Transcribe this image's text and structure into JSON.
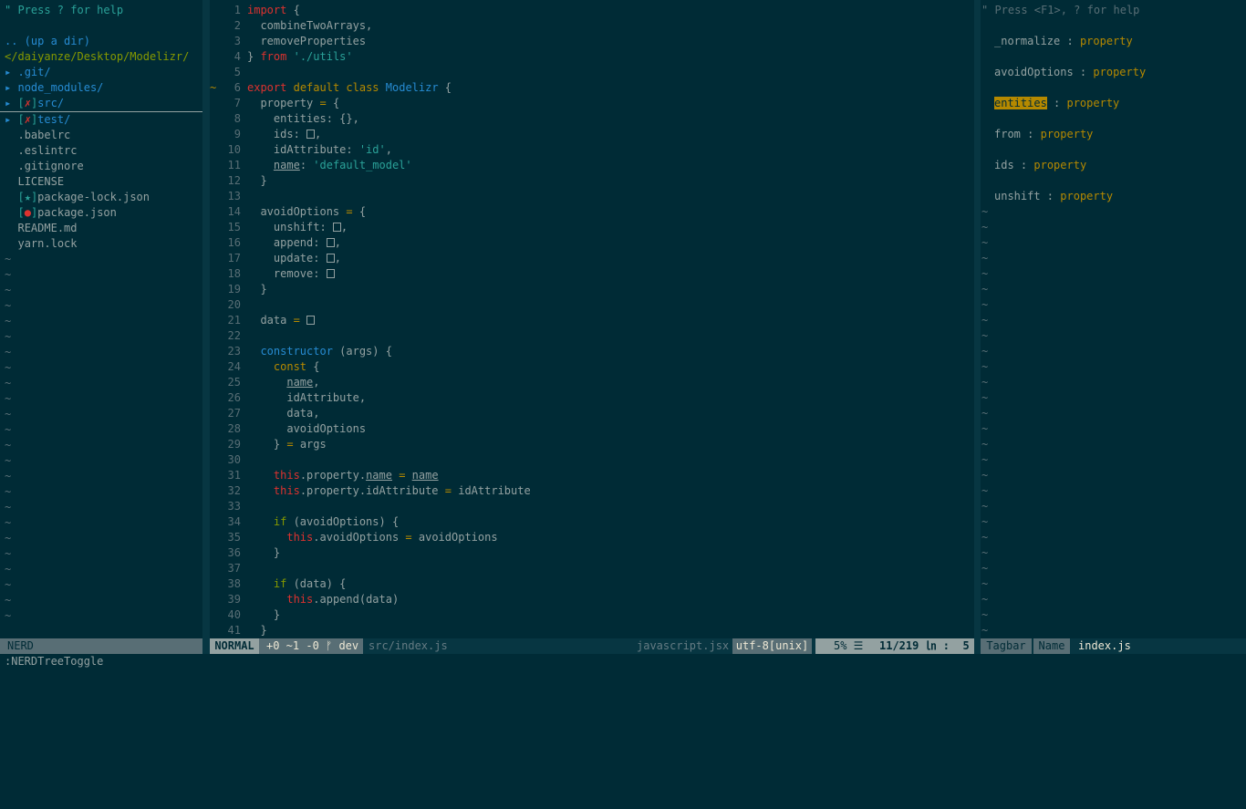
{
  "nerdtree": {
    "help": "\" Press ? for help",
    "up": ".. (up a dir)",
    "root": "</daiyanze/Desktop/Modelizr/",
    "entries": [
      {
        "arrow": "▸",
        "mark": "",
        "name": ".git/",
        "type": "dir"
      },
      {
        "arrow": "▸",
        "mark": "",
        "name": "node_modules/",
        "type": "dir"
      },
      {
        "arrow": "▸",
        "mark": "✗",
        "name": "src/",
        "type": "dir"
      },
      {
        "arrow": "▸",
        "mark": "✗",
        "name": "test/",
        "type": "dir"
      },
      {
        "arrow": " ",
        "mark": "",
        "name": ".babelrc",
        "type": "file"
      },
      {
        "arrow": " ",
        "mark": "",
        "name": ".eslintrc",
        "type": "file"
      },
      {
        "arrow": " ",
        "mark": "",
        "name": ".gitignore",
        "type": "file"
      },
      {
        "arrow": " ",
        "mark": "",
        "name": "LICENSE",
        "type": "file"
      },
      {
        "arrow": " ",
        "mark": "★",
        "name": "package-lock.json",
        "type": "file"
      },
      {
        "arrow": " ",
        "mark": "●",
        "name": "package.json",
        "type": "file"
      },
      {
        "arrow": " ",
        "mark": "",
        "name": "README.md",
        "type": "file"
      },
      {
        "arrow": " ",
        "mark": "",
        "name": "yarn.lock",
        "type": "file"
      }
    ],
    "empty_marker": "~"
  },
  "editor": {
    "lines": [
      [
        [
          "import",
          "kw"
        ],
        [
          " {",
          "t"
        ]
      ],
      [
        [
          "  combineTwoArrays,",
          "t"
        ]
      ],
      [
        [
          "  removeProperties",
          "t"
        ]
      ],
      [
        [
          "} ",
          "t"
        ],
        [
          "from",
          "kw"
        ],
        [
          " ",
          "t"
        ],
        [
          "'./utils'",
          "str"
        ]
      ],
      [],
      [
        [
          "export",
          "kw"
        ],
        [
          " ",
          "t"
        ],
        [
          "default",
          "op"
        ],
        [
          " ",
          "t"
        ],
        [
          "class",
          "op"
        ],
        [
          " ",
          "t"
        ],
        [
          "Modelizr",
          "fn"
        ],
        [
          " {",
          "t"
        ]
      ],
      [
        [
          "  property ",
          "t"
        ],
        [
          "=",
          "op"
        ],
        [
          " {",
          "t"
        ]
      ],
      [
        [
          "    entities: {},",
          "t"
        ]
      ],
      [
        [
          "    ids: ",
          "t"
        ],
        [
          "[]",
          "box"
        ],
        [
          ",",
          "t"
        ]
      ],
      [
        [
          "    idAttribute: ",
          "t"
        ],
        [
          "'id'",
          "str"
        ],
        [
          ",",
          "t"
        ]
      ],
      [
        [
          "    ",
          "t"
        ],
        [
          "name",
          "u"
        ],
        [
          ": ",
          "t"
        ],
        [
          "'default_model'",
          "str"
        ]
      ],
      [
        [
          "  }",
          "t"
        ]
      ],
      [],
      [
        [
          "  avoidOptions ",
          "t"
        ],
        [
          "=",
          "op"
        ],
        [
          " {",
          "t"
        ]
      ],
      [
        [
          "    unshift: ",
          "t"
        ],
        [
          "[]",
          "box"
        ],
        [
          ",",
          "t"
        ]
      ],
      [
        [
          "    append: ",
          "t"
        ],
        [
          "[]",
          "box"
        ],
        [
          ",",
          "t"
        ]
      ],
      [
        [
          "    update: ",
          "t"
        ],
        [
          "[]",
          "box"
        ],
        [
          ",",
          "t"
        ]
      ],
      [
        [
          "    remove: ",
          "t"
        ],
        [
          "[]",
          "box"
        ]
      ],
      [
        [
          "  }",
          "t"
        ]
      ],
      [],
      [
        [
          "  data ",
          "t"
        ],
        [
          "=",
          "op"
        ],
        [
          " ",
          "t"
        ],
        [
          "[]",
          "box"
        ]
      ],
      [],
      [
        [
          "  ",
          "t"
        ],
        [
          "constructor",
          "fn"
        ],
        [
          " (args) {",
          "t"
        ]
      ],
      [
        [
          "    ",
          "t"
        ],
        [
          "const",
          "op"
        ],
        [
          " {",
          "t"
        ]
      ],
      [
        [
          "      ",
          "t"
        ],
        [
          "name",
          "u"
        ],
        [
          ",",
          "t"
        ]
      ],
      [
        [
          "      idAttribute,",
          "t"
        ]
      ],
      [
        [
          "      data,",
          "t"
        ]
      ],
      [
        [
          "      avoidOptions",
          "t"
        ]
      ],
      [
        [
          "    } ",
          "t"
        ],
        [
          "=",
          "op"
        ],
        [
          " args",
          "t"
        ]
      ],
      [],
      [
        [
          "    ",
          "t"
        ],
        [
          "this",
          "this"
        ],
        [
          ".property.",
          "t"
        ],
        [
          "name",
          "u"
        ],
        [
          " ",
          "t"
        ],
        [
          "=",
          "op"
        ],
        [
          " ",
          "t"
        ],
        [
          "name",
          "u"
        ]
      ],
      [
        [
          "    ",
          "t"
        ],
        [
          "this",
          "this"
        ],
        [
          ".property.idAttribute ",
          "t"
        ],
        [
          "=",
          "op"
        ],
        [
          " idAttribute",
          "t"
        ]
      ],
      [],
      [
        [
          "    ",
          "t"
        ],
        [
          "if",
          "st"
        ],
        [
          " (avoidOptions) {",
          "t"
        ]
      ],
      [
        [
          "      ",
          "t"
        ],
        [
          "this",
          "this"
        ],
        [
          ".avoidOptions ",
          "t"
        ],
        [
          "=",
          "op"
        ],
        [
          " avoidOptions",
          "t"
        ]
      ],
      [
        [
          "    }",
          "t"
        ]
      ],
      [],
      [
        [
          "    ",
          "t"
        ],
        [
          "if",
          "st"
        ],
        [
          " (data) {",
          "t"
        ]
      ],
      [
        [
          "      ",
          "t"
        ],
        [
          "this",
          "this"
        ],
        [
          ".append(data)",
          "t"
        ]
      ],
      [
        [
          "    }",
          "t"
        ]
      ],
      [
        [
          "  }",
          "t"
        ]
      ]
    ],
    "sign_line": 6,
    "sign_char": "~"
  },
  "tagbar": {
    "help": "\" Press <F1>, ? for help",
    "tags": [
      {
        "name": "_normalize",
        "kind": "property"
      },
      {
        "name": "avoidOptions",
        "kind": "property"
      },
      {
        "name": "entities",
        "kind": "property",
        "highlight": true
      },
      {
        "name": "from",
        "kind": "property"
      },
      {
        "name": "ids",
        "kind": "property"
      },
      {
        "name": "unshift",
        "kind": "property"
      }
    ]
  },
  "status": {
    "nerd_label": "NERD",
    "mode": "NORMAL",
    "git": "+0 ~1 -0 ᚠ dev",
    "file": "src/index.js",
    "filetype": "javascript.jsx",
    "encoding": "utf-8[unix]",
    "percent": "5% ☰",
    "position": "11/219 ㏑ :  5",
    "tagbar": "Tagbar",
    "tagbar_sort": "Name",
    "tagbar_file": "index.js"
  },
  "command_line": ":NERDTreeToggle",
  "colors": {
    "background": "#002b36",
    "panel": "#073642",
    "keyword_red": "#dc322f",
    "yellow": "#b58900",
    "blue": "#268bd2",
    "cyan": "#2aa198",
    "green": "#859900"
  }
}
